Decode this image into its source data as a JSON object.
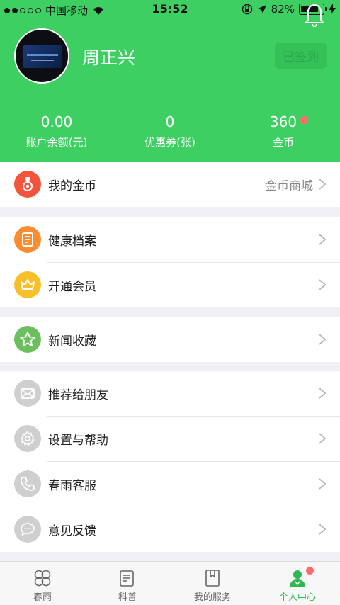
{
  "status_bar": {
    "carrier": "中国移动",
    "time": "15:52",
    "battery": "82%",
    "battery_level": 0.82
  },
  "profile": {
    "username": "周正兴",
    "signin_label": "已签到"
  },
  "stats": [
    {
      "value": "0.00",
      "label": "账户余额(元)"
    },
    {
      "value": "0",
      "label": "优惠券(张)"
    },
    {
      "value": "360",
      "label": "金币",
      "has_badge": true
    }
  ],
  "menu": {
    "coins": {
      "label": "我的金币",
      "extra": "金币商城",
      "icon": "medal-icon",
      "color": "#f4543c"
    },
    "health": {
      "label": "健康档案",
      "icon": "document-icon",
      "color": "#fb8c2f"
    },
    "vip": {
      "label": "开通会员",
      "icon": "crown-icon",
      "color": "#f7c02a"
    },
    "news": {
      "label": "新闻收藏",
      "icon": "star-icon",
      "color": "#6cbf5d"
    },
    "recommend": {
      "label": "推荐给朋友",
      "icon": "envelope-icon",
      "color": "#cfcfcf"
    },
    "settings": {
      "label": "设置与帮助",
      "icon": "gear-icon",
      "color": "#cfcfcf"
    },
    "service": {
      "label": "春雨客服",
      "icon": "phone-icon",
      "color": "#cfcfcf"
    },
    "feedback": {
      "label": "意见反馈",
      "icon": "chat-bubble-icon",
      "color": "#cfcfcf"
    }
  },
  "tabs": [
    {
      "label": "春雨",
      "icon": "clover-icon"
    },
    {
      "label": "科普",
      "icon": "scroll-icon"
    },
    {
      "label": "我的服务",
      "icon": "book-icon"
    },
    {
      "label": "个人中心",
      "icon": "person-icon",
      "active": true
    }
  ],
  "colors": {
    "header": "#3ecf63",
    "active_tab": "#2eb84f",
    "badge": "#ff6b6b"
  }
}
